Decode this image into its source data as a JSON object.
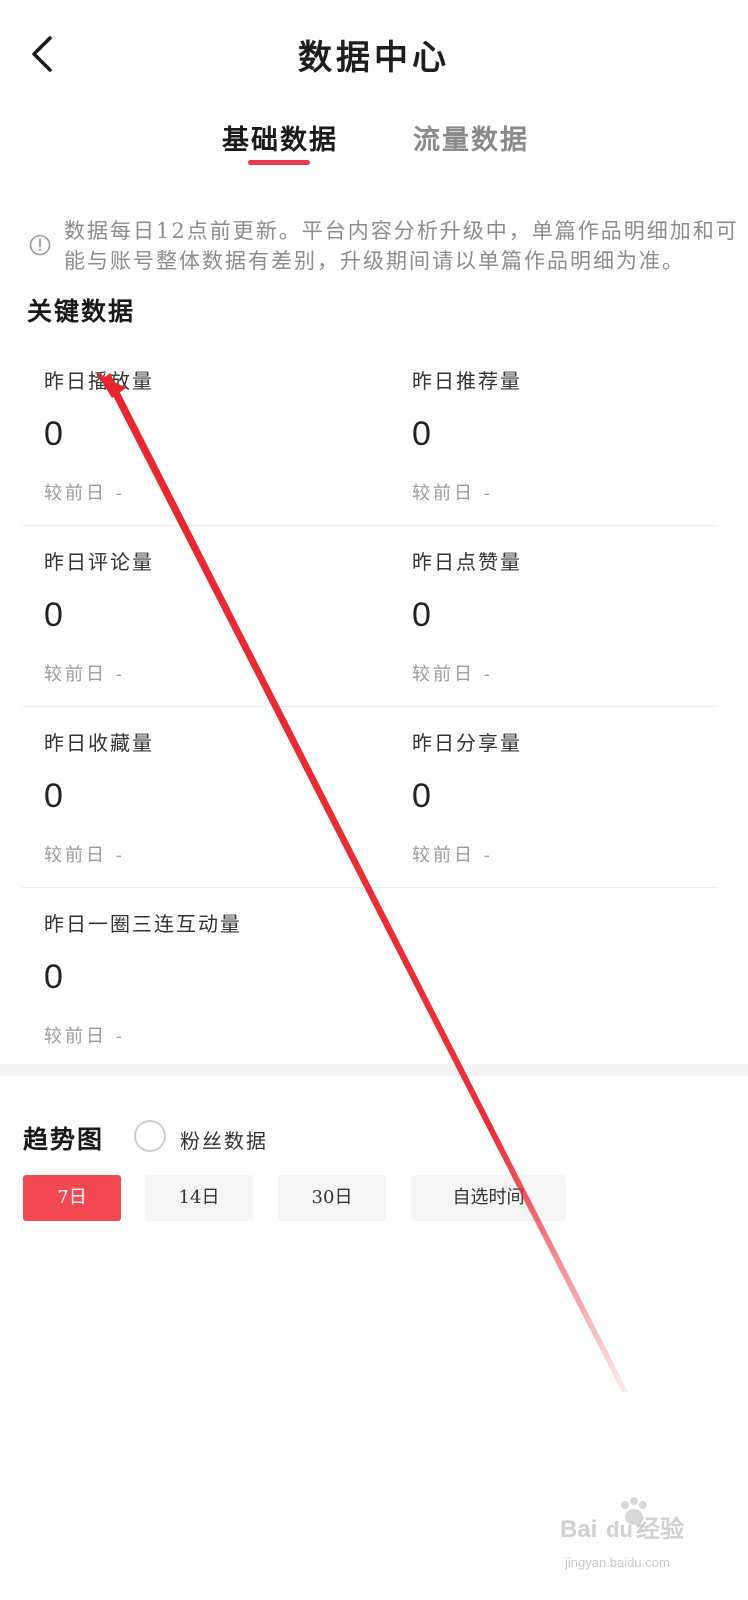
{
  "header": {
    "title": "数据中心"
  },
  "tabs": [
    {
      "label": "基础数据",
      "active": true
    },
    {
      "label": "流量数据",
      "active": false
    }
  ],
  "notice": {
    "text": "数据每日12点前更新。平台内容分析升级中，单篇作品明细加和可能与账号整体数据有差别，升级期间请以单篇作品明细为准。"
  },
  "key_data": {
    "title": "关键数据",
    "metrics": [
      {
        "label": "昨日播放量",
        "value": "0",
        "compare": "较前日 -"
      },
      {
        "label": "昨日推荐量",
        "value": "0",
        "compare": "较前日 -"
      },
      {
        "label": "昨日评论量",
        "value": "0",
        "compare": "较前日 -"
      },
      {
        "label": "昨日点赞量",
        "value": "0",
        "compare": "较前日 -"
      },
      {
        "label": "昨日收藏量",
        "value": "0",
        "compare": "较前日 -"
      },
      {
        "label": "昨日分享量",
        "value": "0",
        "compare": "较前日 -"
      },
      {
        "label": "昨日一圈三连互动量",
        "value": "0",
        "compare": "较前日 -"
      }
    ]
  },
  "trend": {
    "title": "趋势图",
    "fans_option": "粉丝数据",
    "ranges": [
      "7日",
      "14日",
      "30日",
      "自选时间"
    ],
    "selected_range": "7日"
  },
  "colors": {
    "accent": "#f24852",
    "tab_underline": "#e8384a",
    "annotation_arrow": "#e8262e"
  },
  "watermark": {
    "text": "jingyan.baidu.com",
    "logo": "Bai du 经验"
  }
}
